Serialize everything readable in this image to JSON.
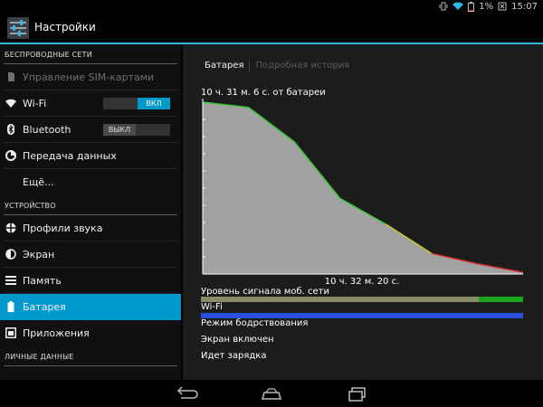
{
  "status": {
    "battery_percent": "1%",
    "time": "15:07"
  },
  "actionbar": {
    "title": "Настройки"
  },
  "sidebar": {
    "sections": [
      {
        "header": "БЕСПРОВОДНЫЕ СЕТИ"
      },
      {
        "header": "УСТРОЙСТВО"
      },
      {
        "header": "ЛИЧНЫЕ ДАННЫЕ"
      }
    ],
    "items": [
      {
        "label": "Управление SIM-картами",
        "icon": "sim-icon",
        "disabled": true
      },
      {
        "label": "Wi-Fi",
        "icon": "wifi-icon",
        "toggle": "ВКЛ"
      },
      {
        "label": "Bluetooth",
        "icon": "bluetooth-icon",
        "toggle": "ВЫКЛ"
      },
      {
        "label": "Передача данных",
        "icon": "data-usage-icon"
      },
      {
        "label": "Ещё..."
      },
      {
        "label": "Профили звука",
        "icon": "sound-icon"
      },
      {
        "label": "Экран",
        "icon": "display-icon"
      },
      {
        "label": "Память",
        "icon": "storage-icon"
      },
      {
        "label": "Батарея",
        "icon": "battery-icon",
        "selected": true
      },
      {
        "label": "Приложения",
        "icon": "apps-icon"
      }
    ]
  },
  "content": {
    "tabs": {
      "active": "Батарея",
      "inactive": "Подробная история"
    },
    "battery_time": "10 ч. 31 м. 6 с. от батареи",
    "chart_footer": "10 ч. 32 м. 20 с.",
    "rows": {
      "signal": "Уровень сигнала моб. сети",
      "wifi": "Wi-Fi",
      "awake": "Режим бодрствования",
      "screen": "Экран включен",
      "charging": "Идет зарядка"
    }
  },
  "chart_data": {
    "type": "area",
    "values": [
      100,
      97,
      77,
      44,
      29,
      12,
      6,
      1
    ],
    "colors": {
      "fill": "#a2a2a2",
      "high": "#37c837",
      "mid": "#c8c832",
      "low": "#d22d2d"
    },
    "gridlines": false
  },
  "colors": {
    "accent": "#0099cc",
    "accent_line": "#33b5e5",
    "wifi_bar": "#2b4fe0",
    "signal_good": "#1aa31a",
    "signal_poor": "#8a8a64"
  }
}
